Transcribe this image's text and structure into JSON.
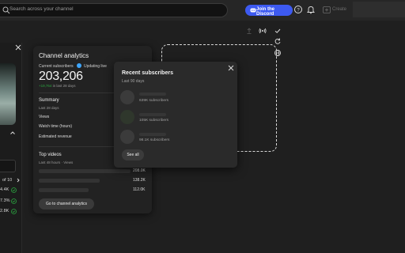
{
  "topbar": {
    "search_placeholder": "Search across your channel",
    "discord_button": "Join the Discord",
    "create_button": "Create"
  },
  "left": {
    "pagination": "of 10",
    "stats": [
      "4.4K",
      "7.3%",
      "2.8K"
    ]
  },
  "analytics": {
    "title": "Channel analytics",
    "current_subscribers_label": "Current subscribers",
    "live_label": "Updating live",
    "subscriber_count": "203,206",
    "delta_value": "+19,764",
    "delta_period": "in last 28 days",
    "summary": {
      "title": "Summary",
      "period": "Last 28 days",
      "metrics": [
        "Views",
        "Watch time (hours)",
        "Estimated revenue"
      ]
    },
    "top_videos": {
      "title": "Top videos",
      "period": "Last 48 hours · Views",
      "values": [
        "208.0K",
        "138.2K",
        "112.0K"
      ],
      "bar_fractions": [
        1.0,
        0.66,
        0.54
      ]
    },
    "cta_button": "Go to channel analytics"
  },
  "recent_subscribers": {
    "title": "Recent subscribers",
    "period": "Last 90 days",
    "items": [
      {
        "count": "639K subscribers"
      },
      {
        "count": "105K subscribers"
      },
      {
        "count": "98.1K subscribers"
      }
    ],
    "see_all": "See all"
  },
  "colors": {
    "accent_blue": "#3ea6ff",
    "discord_blue": "#3d5af1",
    "positive_green": "#2ba640"
  },
  "icons": [
    "search-icon",
    "discord-icon",
    "help-icon",
    "bell-icon",
    "create-icon",
    "upload-icon",
    "broadcast-icon",
    "check-icon",
    "refresh-icon",
    "globe-icon",
    "close-icon",
    "chevron-up-icon",
    "chevron-right-icon",
    "check-circle-icon"
  ]
}
